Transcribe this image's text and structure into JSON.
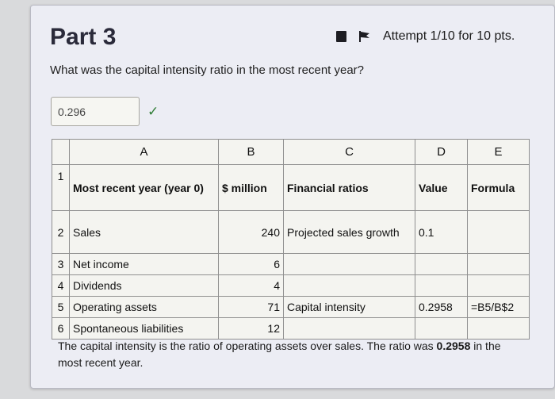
{
  "part": {
    "title": "Part 3"
  },
  "attempt": {
    "text": "Attempt 1/10 for 10 pts."
  },
  "question": {
    "text": "What was the capital intensity ratio in the most recent year?"
  },
  "answer": {
    "value": "0.296",
    "status_icon": "check-icon",
    "status_color": "#2f7d35"
  },
  "sheet": {
    "columns": [
      "A",
      "B",
      "C",
      "D",
      "E"
    ],
    "rows": [
      {
        "num": "1",
        "a": "Most recent year (year 0)",
        "b": "$ million",
        "c": "Financial ratios",
        "d": "Value",
        "e": "Formula"
      },
      {
        "num": "2",
        "a": "Sales",
        "b": "240",
        "c": "Projected sales growth",
        "d": "0.1",
        "e": ""
      },
      {
        "num": "3",
        "a": "Net income",
        "b": "6",
        "c": "",
        "d": "",
        "e": ""
      },
      {
        "num": "4",
        "a": "Dividends",
        "b": "4",
        "c": "",
        "d": "",
        "e": ""
      },
      {
        "num": "5",
        "a": "Operating assets",
        "b": "71",
        "c": "Capital intensity",
        "d": "0.2958",
        "e": "=B5/B$2"
      },
      {
        "num": "6",
        "a": "Spontaneous liabilities",
        "b": "12",
        "c": "",
        "d": "",
        "e": ""
      }
    ]
  },
  "explanation": {
    "line1": "The capital intensity is the ratio of operating assets over sales. The ratio was",
    "bold_value": "0.2958",
    "line2_rest": " in the most recent year."
  }
}
